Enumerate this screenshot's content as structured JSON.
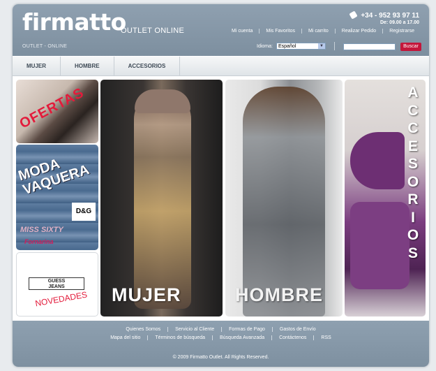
{
  "header": {
    "logo": "firmatto",
    "logo_sub": "OUTLET ONLINE",
    "tagline": "OUTLET - ONLINE",
    "phone": "+34 - 952 93 97 11",
    "hours": "De: 09.00 a 17.00",
    "links": [
      "Mi cuenta",
      "Mis Favoritos",
      "Mi carrito",
      "Realizar Pedido",
      "Registrarse"
    ],
    "language_label": "Idioma:",
    "language_value": "Español",
    "search_button": "Buscar"
  },
  "nav": {
    "items": [
      "MUJER",
      "HOMBRE",
      "ACCESORIOS"
    ]
  },
  "banners": {
    "ofertas": "OFERTAS",
    "moda_line1": "MODA",
    "moda_line2": "VAQUERA",
    "dg": "D&G",
    "miss_sixty": "MISS SIXTY",
    "fornarina": "Fornarina",
    "guess_line1": "GUESS",
    "guess_line2": "JEANS",
    "novedades": "NOVEDADES",
    "mujer": "MUJER",
    "hombre": "HOMBRE",
    "accesorios_letters": [
      "A",
      "C",
      "C",
      "E",
      "S",
      "O",
      "R",
      "I",
      "O",
      "S"
    ]
  },
  "footer": {
    "row1": [
      "Quienes Somos",
      "Servicio al Cliente",
      "Formas de Pago",
      "Gastos de Envío"
    ],
    "row2": [
      "Mapa del sitio",
      "Términos de búsqueda",
      "Búsqueda Avanzada",
      "Contáctenos",
      "RSS"
    ],
    "copyright": "© 2009 Firmatto Outlet. All Rights Reserved."
  },
  "colors": {
    "header_bg": "#7d8f9f",
    "accent_red": "#c4163b",
    "nav_text": "#3e4a56"
  },
  "icons": {
    "phone": "phone-icon",
    "select_arrow": "chevron-down-icon"
  }
}
